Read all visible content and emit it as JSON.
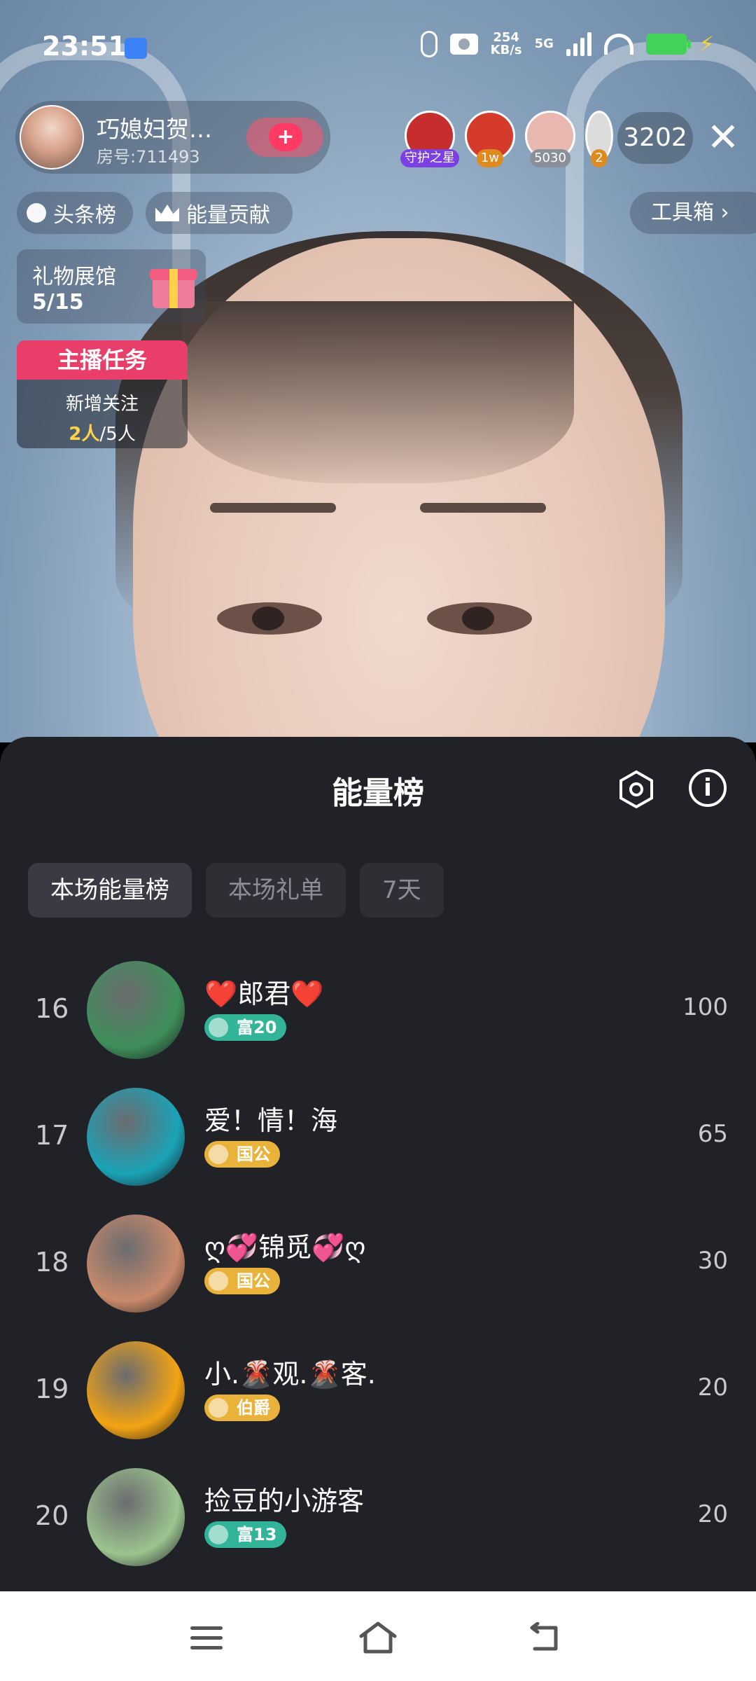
{
  "status": {
    "time": "23:51",
    "speed_top": "254",
    "speed_bottom": "KB/s",
    "network": "5G"
  },
  "host": {
    "name": "巧媳妇贺…",
    "room": "房号:711493",
    "follow_symbol": "+"
  },
  "fans": [
    {
      "badge": "守护之星",
      "badge_color": "#7b3fe4",
      "color": "#c62d2d"
    },
    {
      "badge": "1w",
      "badge_color": "#e08a1e",
      "color": "#d43b2a"
    },
    {
      "badge": "5030",
      "badge_color": "#8a8f99",
      "color": "#e8b7b0"
    },
    {
      "badge": "2",
      "badge_color": "#e08a1e",
      "color": "#dcdcdc"
    }
  ],
  "viewer_count": "3202",
  "close_symbol": "✕",
  "chips": {
    "headlines": "头条榜",
    "energy": "能量贡献",
    "toolbox": "工具箱 ›"
  },
  "gift_hall": {
    "title": "礼物展馆",
    "progress": "5/15"
  },
  "task": {
    "title": "主播任务",
    "line1": "新增关注",
    "done": "2人",
    "total": "/5人"
  },
  "sheet": {
    "title": "能量榜",
    "info_symbol": "i",
    "tabs": [
      "本场能量榜",
      "本场礼单",
      "7天"
    ],
    "rows": [
      {
        "rank": "16",
        "name": "❤️郎君❤️",
        "badge": "富20",
        "badge_type": "green",
        "score": "100",
        "avatar": "#3f8f5a"
      },
      {
        "rank": "17",
        "name": "爱！情！海",
        "badge": "国公",
        "badge_type": "gold",
        "score": "65",
        "avatar": "#1aa3b7"
      },
      {
        "rank": "18",
        "name": "ღ💞锦觅💞ღ",
        "badge": "国公",
        "badge_type": "gold",
        "score": "30",
        "avatar": "#c98a6b"
      },
      {
        "rank": "19",
        "name": "小.🌋观.🌋客.",
        "badge": "伯爵",
        "badge_type": "gold",
        "score": "20",
        "avatar": "#f2a313"
      },
      {
        "rank": "20",
        "name": "捡豆的小游客",
        "badge": "富13",
        "badge_type": "green",
        "score": "20",
        "avatar": "#9cc48f"
      }
    ]
  }
}
